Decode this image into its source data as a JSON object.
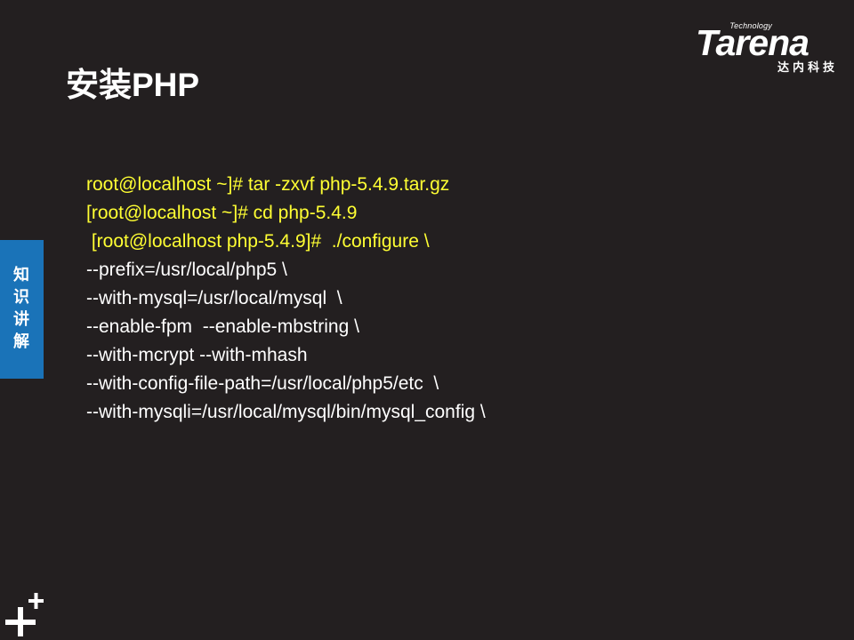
{
  "logo": {
    "technology": "Technology",
    "name": "Tarena",
    "chinese": "达内科技"
  },
  "title": "安装PHP",
  "side_tab": "知识讲解",
  "code_lines": [
    {
      "text": "root@localhost ~]# tar -zxvf php-5.4.9.tar.gz",
      "color": "#ffff33"
    },
    {
      "text": "[root@localhost ~]# cd php-5.4.9",
      "color": "#ffff33"
    },
    {
      "text": " [root@localhost php-5.4.9]#  ./configure \\",
      "color": "#ffff33"
    },
    {
      "text": "--prefix=/usr/local/php5 \\",
      "color": "#ffffff"
    },
    {
      "text": "--with-mysql=/usr/local/mysql  \\",
      "color": "#ffffff"
    },
    {
      "text": "--enable-fpm  --enable-mbstring \\",
      "color": "#ffffff"
    },
    {
      "text": "--with-mcrypt --with-mhash",
      "color": "#ffffff"
    },
    {
      "text": "--with-config-file-path=/usr/local/php5/etc  \\",
      "color": "#ffffff"
    },
    {
      "text": "--with-mysqli=/usr/local/mysql/bin/mysql_config \\",
      "color": "#ffffff"
    }
  ],
  "colors": {
    "background": "#231f20",
    "accent_tab": "#1a73b8",
    "command_highlight": "#ffff33"
  },
  "icons": {
    "bottom_left": "plus-plus-icon"
  }
}
